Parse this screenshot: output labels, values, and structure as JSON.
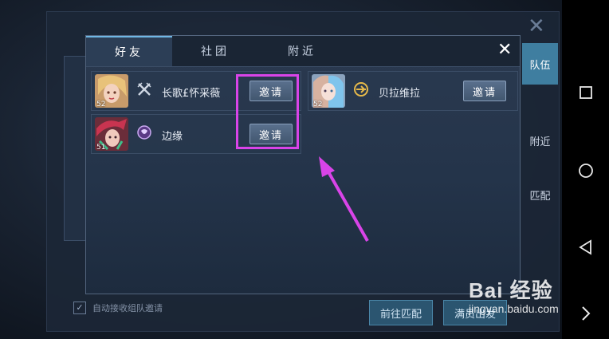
{
  "background": {
    "side_tabs": [
      {
        "label": "队伍",
        "active": true
      },
      {
        "label": "附近",
        "active": false
      },
      {
        "label": "匹配",
        "active": false
      }
    ],
    "auto_accept_label": "自动接收组队邀请",
    "bottom_buttons": [
      "前往匹配",
      "满员出发"
    ],
    "close_glyph": "✕"
  },
  "modal": {
    "tabs": [
      {
        "label": "好友",
        "active": true
      },
      {
        "label": "社团",
        "active": false
      },
      {
        "label": "附近",
        "active": false
      }
    ],
    "close_glyph": "✕",
    "friends": [
      {
        "level": "52",
        "name": "长歌£怀采薇",
        "rank_icon": "crossed-swords-icon",
        "invite_label": "邀请"
      },
      {
        "level": "52",
        "name": "贝拉维拉",
        "rank_icon": "gold-emblem-icon",
        "invite_label": "邀请"
      },
      {
        "level": "51",
        "name": "边缘",
        "rank_icon": "purple-emblem-icon",
        "invite_label": "邀请"
      }
    ]
  },
  "navbar": {
    "icons": [
      "square-icon",
      "circle-icon",
      "triangle-back-icon",
      "chevron-right-icon"
    ]
  },
  "watermark": {
    "brand": "Bai 经验",
    "url": "jingyan.baidu.com"
  },
  "colors": {
    "highlight": "#d944e8",
    "tab_accent": "#6fb7e4"
  }
}
